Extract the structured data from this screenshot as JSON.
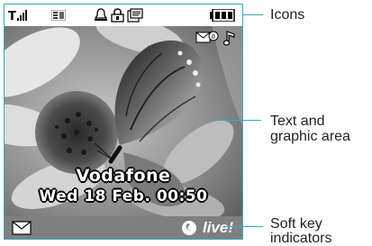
{
  "phone_screen": {
    "status_icons": [
      "signal-strength-icon",
      "3g-icon",
      "alarm-bell-icon",
      "lock-icon",
      "message-card-icon",
      "battery-icon"
    ],
    "overlay_icons": [
      "voice-mail-icon",
      "music-note-icon"
    ],
    "wallpaper": "butterfly-on-flower-photo",
    "operator_name": "Vodafone",
    "datetime": "Wed 18 Feb. 00:50",
    "softkeys": {
      "left_icon": "envelope-icon",
      "right_label": "live!",
      "right_logo": "vodafone-logo-icon"
    }
  },
  "callouts": {
    "icons": "Icons",
    "text_graphic_line1": "Text and",
    "text_graphic_line2": "graphic area",
    "softkey_line1": "Soft key",
    "softkey_line2": "indicators"
  },
  "colors": {
    "callout_line": "#3aa8c6",
    "softbar": "#7f7f7f"
  }
}
